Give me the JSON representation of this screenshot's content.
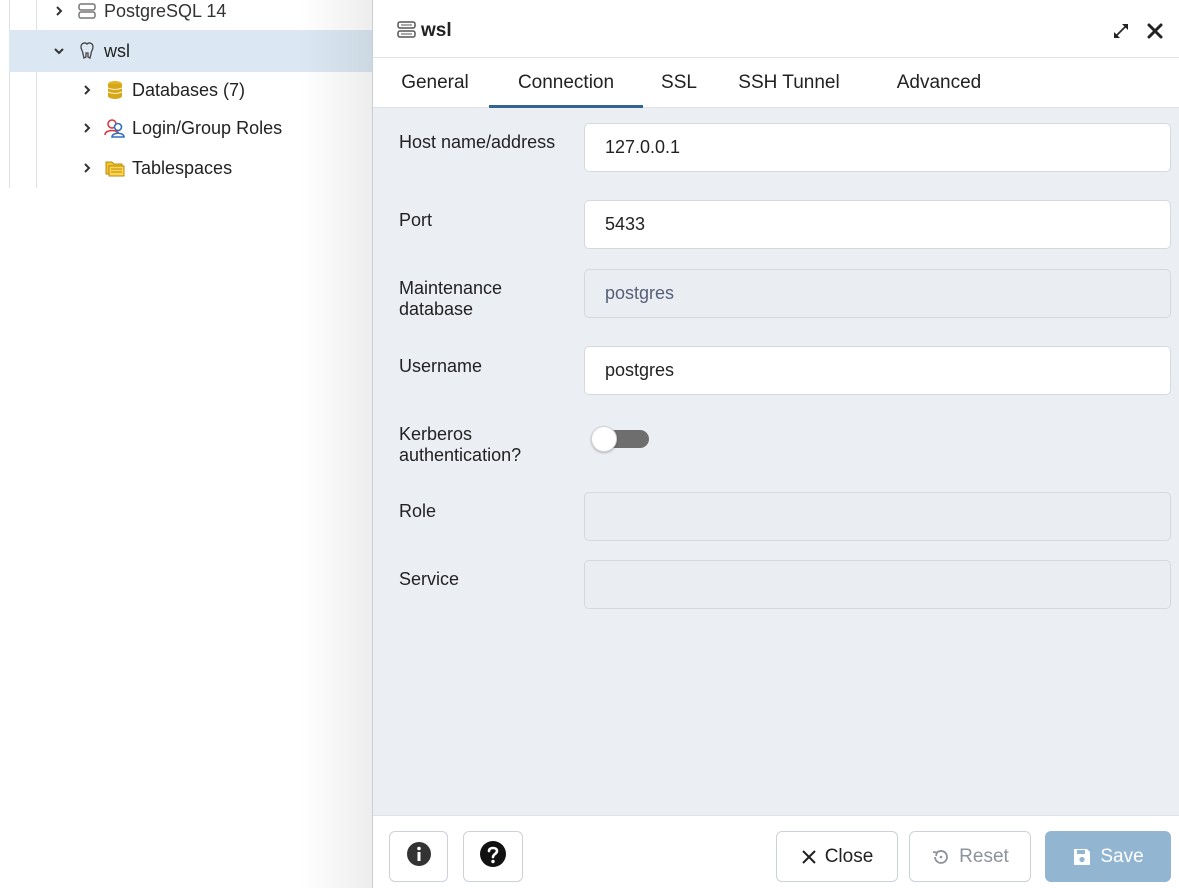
{
  "tree": {
    "items": [
      {
        "label": "PostgreSQL 14",
        "icon": "server-icon"
      },
      {
        "label": "wsl",
        "icon": "postgres-elephant-icon",
        "selected": true
      },
      {
        "label": "Databases (7)",
        "icon": "database-icon"
      },
      {
        "label": "Login/Group Roles",
        "icon": "login-roles-icon"
      },
      {
        "label": "Tablespaces",
        "icon": "tablespaces-icon"
      }
    ]
  },
  "dialog": {
    "title": "wsl",
    "tabs": [
      {
        "label": "General"
      },
      {
        "label": "Connection",
        "active": true
      },
      {
        "label": "SSL"
      },
      {
        "label": "SSH Tunnel"
      },
      {
        "label": "Advanced"
      }
    ],
    "fields": {
      "host": {
        "label": "Host name/address",
        "value": "127.0.0.1"
      },
      "port": {
        "label": "Port",
        "value": "5433"
      },
      "maintenance_db": {
        "label": "Maintenance database",
        "value": "postgres",
        "disabled": true
      },
      "username": {
        "label": "Username",
        "value": "postgres"
      },
      "kerberos": {
        "label": "Kerberos authentication?",
        "on": false
      },
      "role": {
        "label": "Role",
        "value": "",
        "disabled": true
      },
      "service": {
        "label": "Service",
        "value": "",
        "disabled": true
      }
    },
    "footer": {
      "close_label": "Close",
      "reset_label": "Reset",
      "save_label": "Save"
    }
  },
  "colors": {
    "accent": "#326690",
    "selected_row": "#dbe8f3",
    "save_button": "#92b5d2",
    "dialog_bg": "#ebeef3"
  }
}
